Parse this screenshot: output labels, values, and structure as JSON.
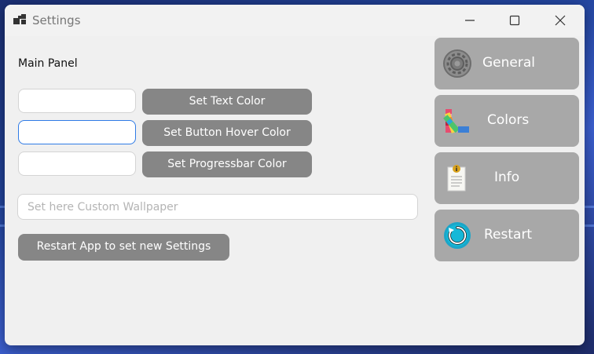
{
  "window": {
    "title": "Settings",
    "controls": {
      "minimize": "—",
      "maximize": "☐",
      "close": "✕"
    }
  },
  "main": {
    "panel_label": "Main Panel",
    "color_inputs": [
      {
        "value": "",
        "button_label": "Set Text Color"
      },
      {
        "value": "",
        "button_label": "Set Button Hover Color"
      },
      {
        "value": "",
        "button_label": "Set Progressbar Color"
      }
    ],
    "wallpaper_input": {
      "value": "",
      "placeholder": "Set here Custom Wallpaper"
    },
    "restart_button_label": "Restart App to set new Settings"
  },
  "sidebar": {
    "items": [
      {
        "label": "General",
        "icon": "gear-icon"
      },
      {
        "label": "Colors",
        "icon": "palette-icon"
      },
      {
        "label": "Info",
        "icon": "info-document-icon"
      },
      {
        "label": "Restart",
        "icon": "restart-icon"
      }
    ]
  },
  "colors": {
    "window_bg": "#f0f0f0",
    "button_bg": "#868686",
    "nav_bg": "#a8a8a8",
    "focus_border": "#2f7be6"
  }
}
